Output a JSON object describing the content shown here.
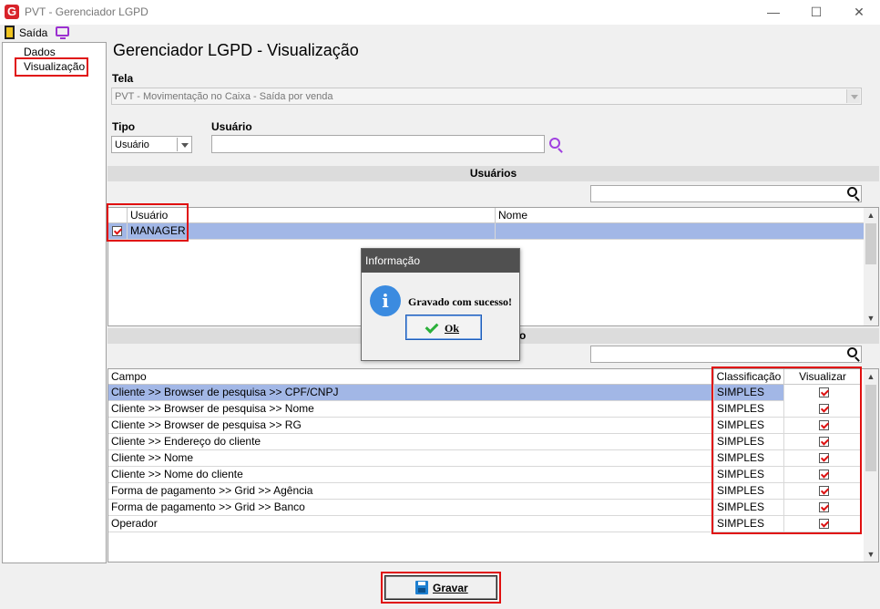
{
  "window": {
    "logo": "G",
    "title": "PVT - Gerenciador LGPD",
    "min": "—",
    "max": "☐",
    "close": "✕"
  },
  "menu": {
    "exit_label": "Saída"
  },
  "tree": {
    "items": [
      "Dados",
      "Visualização"
    ],
    "selected": "Visualização"
  },
  "page_title": "Gerenciador LGPD - Visualização",
  "tela": {
    "label": "Tela",
    "value": "PVT - Movimentação no Caixa - Saída por venda"
  },
  "tipo": {
    "label": "Tipo",
    "value": "Usuário"
  },
  "usuario": {
    "label": "Usuário",
    "value": ""
  },
  "users_section": {
    "title": "Usuários",
    "columns": [
      "Usuário",
      "Nome"
    ],
    "rows": [
      {
        "usuario": "MANAGER",
        "nome": "",
        "checked": true
      }
    ]
  },
  "fields_section": {
    "title_fragment": "o",
    "columns": [
      "Campo",
      "Classificação",
      "Visualizar"
    ],
    "rows": [
      {
        "campo": "Cliente  >> Browser de pesquisa >> CPF/CNPJ",
        "class": "SIMPLES",
        "visualizar": true
      },
      {
        "campo": "Cliente  >> Browser de pesquisa >> Nome",
        "class": "SIMPLES",
        "visualizar": true
      },
      {
        "campo": "Cliente  >> Browser de pesquisa >> RG",
        "class": "SIMPLES",
        "visualizar": true
      },
      {
        "campo": "Cliente >> Endereço do cliente",
        "class": "SIMPLES",
        "visualizar": true
      },
      {
        "campo": "Cliente >> Nome",
        "class": "SIMPLES",
        "visualizar": true
      },
      {
        "campo": "Cliente >> Nome do cliente",
        "class": "SIMPLES",
        "visualizar": true
      },
      {
        "campo": "Forma de pagamento >> Grid >> Agência",
        "class": "SIMPLES",
        "visualizar": true
      },
      {
        "campo": "Forma de pagamento >> Grid >> Banco",
        "class": "SIMPLES",
        "visualizar": true
      },
      {
        "campo": "Operador",
        "class": "SIMPLES",
        "visualizar": true
      }
    ]
  },
  "dialog": {
    "title": "Informação",
    "icon": "i",
    "message": "Gravado com sucesso!",
    "ok_label": "Ok"
  },
  "save_button": {
    "label": "Gravar"
  },
  "colors": {
    "highlight": "#e01010",
    "selection": "#a2b7e6"
  }
}
